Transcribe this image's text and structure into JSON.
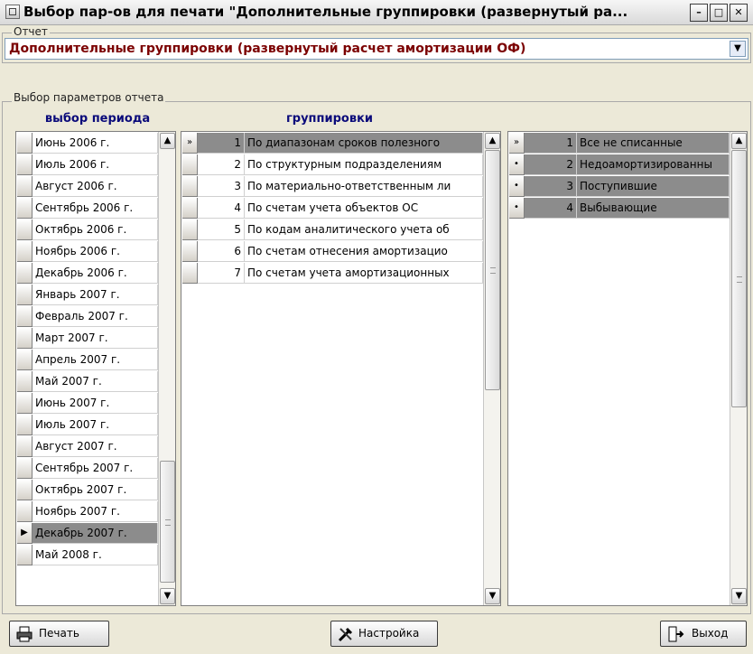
{
  "window": {
    "title": "Выбор пар-ов для печати \"Дополнительные группировки (развернутый ра...",
    "buttons": [
      "–",
      "□",
      "✕"
    ]
  },
  "report": {
    "legend": "Отчет",
    "selected": "Дополнительные группировки (развернутый расчет амортизации ОФ)"
  },
  "params": {
    "legend": "Выбор параметров отчета",
    "period_header": "выбор периода",
    "grouping_header": "группировки"
  },
  "periods": [
    "Июнь 2006 г.",
    "Июль 2006 г.",
    "Август 2006 г.",
    "Сентябрь 2006 г.",
    "Октябрь 2006 г.",
    "Ноябрь 2006 г.",
    "Декабрь 2006 г.",
    "Январь 2007 г.",
    "Февраль 2007 г.",
    "Март 2007 г.",
    "Апрель 2007 г.",
    "Май 2007 г.",
    "Июнь 2007 г.",
    "Июль 2007 г.",
    "Август 2007 г.",
    "Сентябрь 2007 г.",
    "Октябрь 2007 г.",
    "Ноябрь 2007 г.",
    "Декабрь 2007 г.",
    "Май 2008 г."
  ],
  "groupings": [
    {
      "num": "1",
      "text": "По диапазонам сроков полезного"
    },
    {
      "num": "2",
      "text": "По структурным подразделениям"
    },
    {
      "num": "3",
      "text": "По материально-ответственным ли"
    },
    {
      "num": "4",
      "text": "По счетам учета объектов ОС"
    },
    {
      "num": "5",
      "text": "По кодам аналитического учета об"
    },
    {
      "num": "6",
      "text": "По счетам отнесения амортизацио"
    },
    {
      "num": "7",
      "text": "По счетам учета амортизационных"
    }
  ],
  "filters": [
    {
      "num": "1",
      "text": "Все не списанные"
    },
    {
      "num": "2",
      "text": "Недоамортизированны"
    },
    {
      "num": "3",
      "text": "Поступившие"
    },
    {
      "num": "4",
      "text": "Выбывающие"
    }
  ],
  "footer": {
    "print": "Печать",
    "settings": "Настройка",
    "exit": "Выход"
  }
}
